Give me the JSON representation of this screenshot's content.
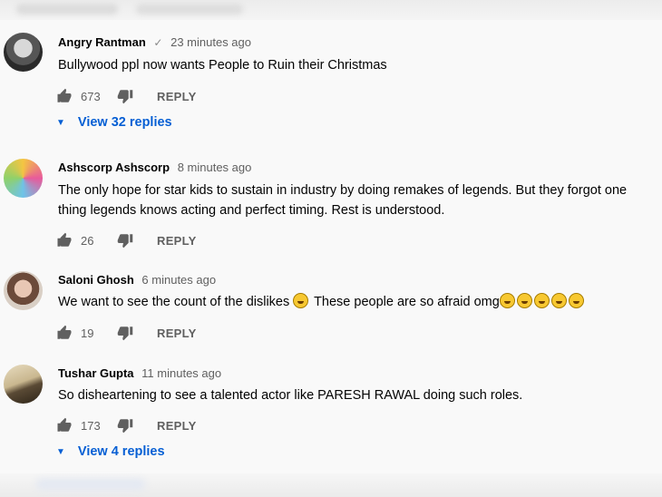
{
  "comments": [
    {
      "author": "Angry Rantman",
      "verified": true,
      "time": "23 minutes ago",
      "text": "Bullywood ppl now wants People to Ruin their Christmas",
      "likes": "673",
      "reply_label": "REPLY",
      "replies_label": "View 32 replies"
    },
    {
      "author": "Ashscorp Ashscorp",
      "verified": false,
      "time": "8 minutes ago",
      "text": "The only hope for star kids to sustain in industry by doing remakes of legends. But they forgot one thing legends knows acting and perfect timing. Rest is understood.",
      "likes": "26",
      "reply_label": "REPLY"
    },
    {
      "author": "Saloni Ghosh",
      "verified": false,
      "time": "6 minutes ago",
      "text_before": "We want to see the count of the dislikes",
      "text_after": "These people are so afraid omg",
      "emoji": "face-with-tears-of-joy",
      "likes": "19",
      "reply_label": "REPLY"
    },
    {
      "author": "Tushar Gupta",
      "verified": false,
      "time": "11 minutes ago",
      "text": "So disheartening to see a talented actor like PARESH RAWAL doing such roles.",
      "likes": "173",
      "reply_label": "REPLY",
      "replies_label": "View 4 replies"
    }
  ],
  "colors": {
    "link": "#065fd4",
    "meta": "#606060",
    "background": "#f9f9f9"
  }
}
